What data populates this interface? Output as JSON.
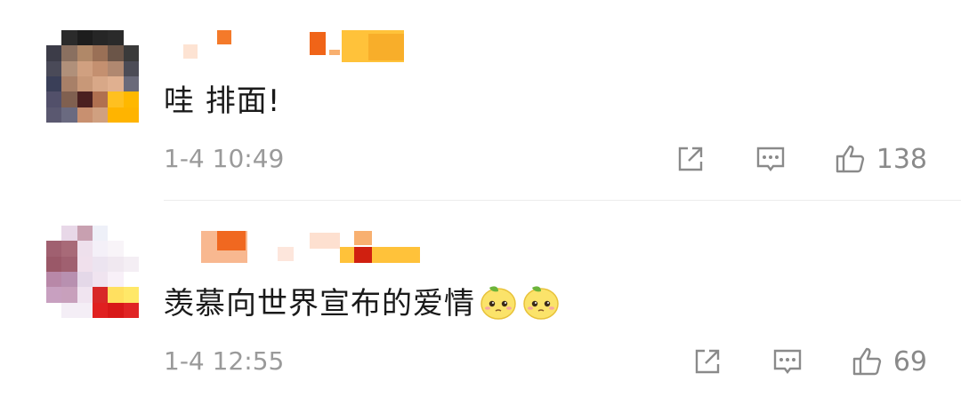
{
  "comments": [
    {
      "text": "哇 排面!",
      "time": "1-4 10:49",
      "likes": "138",
      "icons": [
        "share-icon",
        "reply-icon",
        "like-icon"
      ]
    },
    {
      "text": "羡慕向世界宣布的爱情",
      "emojis": [
        "lemon-emoji",
        "lemon-emoji"
      ],
      "time": "1-4 12:55",
      "likes": "69",
      "icons": [
        "share-icon",
        "reply-icon",
        "like-icon"
      ]
    }
  ],
  "colors": {
    "meta_text": "#9a9a9a",
    "icon": "#8a8a8a",
    "divider": "#ececec"
  }
}
